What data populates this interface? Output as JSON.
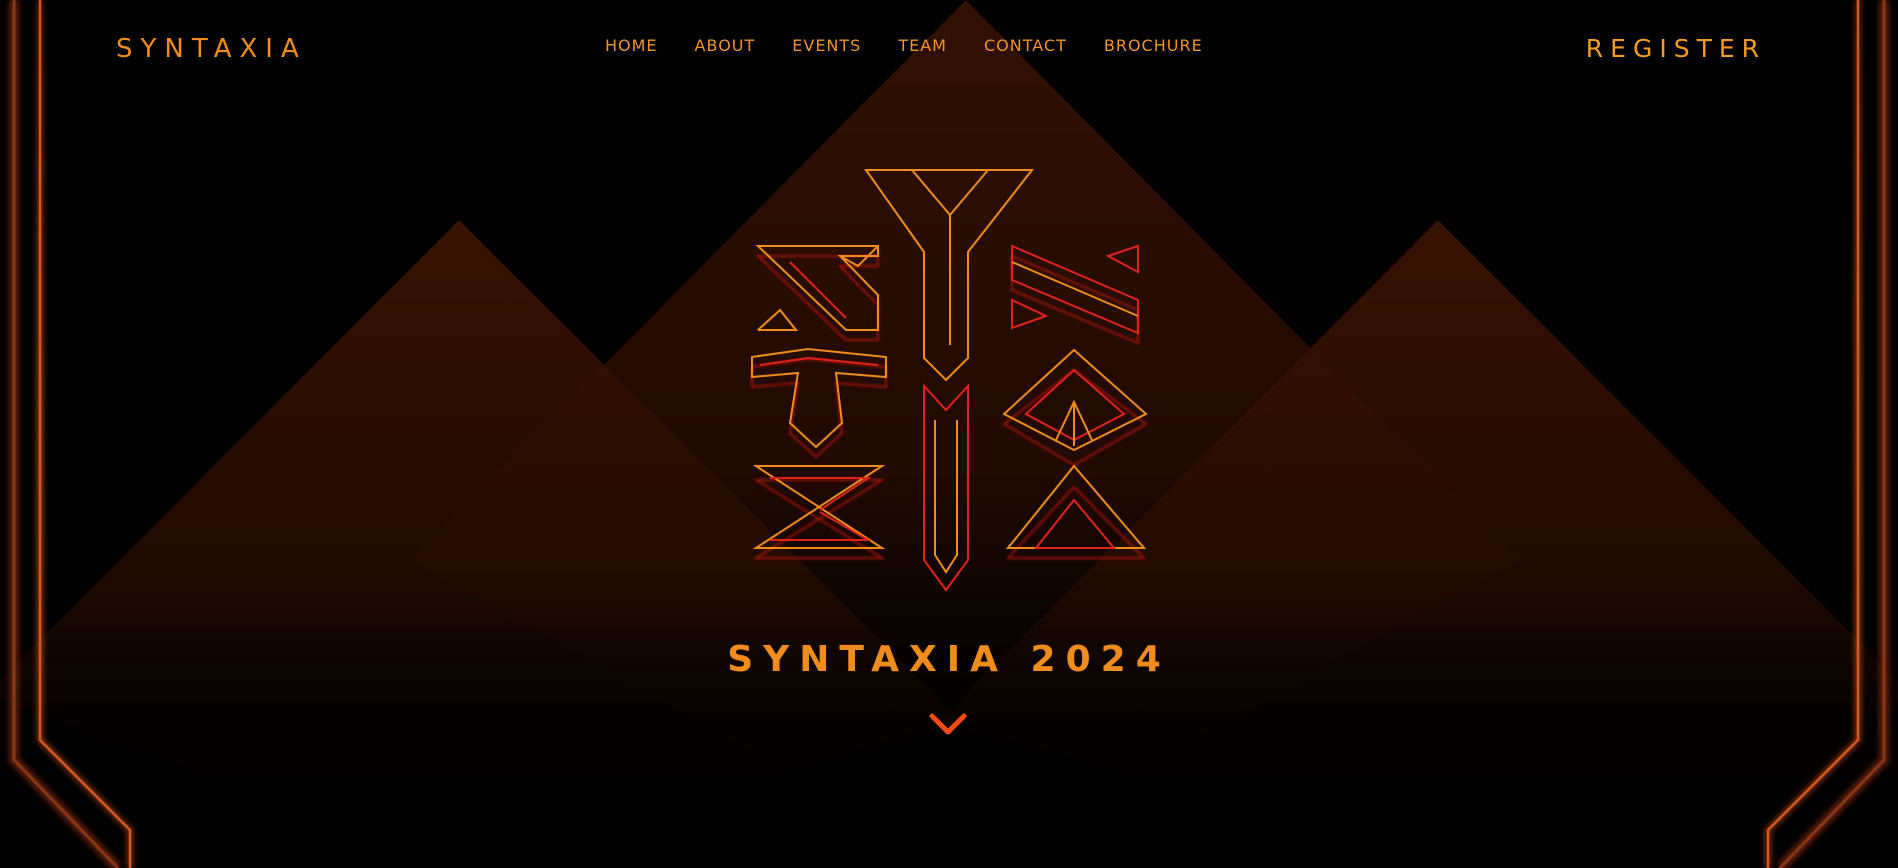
{
  "header": {
    "brand": "SYNTAXIA",
    "nav": [
      "HOME",
      "ABOUT",
      "EVENTS",
      "TEAM",
      "CONTACT",
      "BROCHURE"
    ],
    "register_label": "REGISTER"
  },
  "hero": {
    "title": "SYNTAXIA 2024",
    "scroll_icon": "chevron-down-icon",
    "logo": "syntaxia-glyph-logo"
  },
  "colors": {
    "background": "#000000",
    "accent_orange": "#ef8c1c",
    "accent_red": "#e0221a",
    "pyramid_brown": "#3a1505",
    "frame_orange": "#c4501b"
  }
}
